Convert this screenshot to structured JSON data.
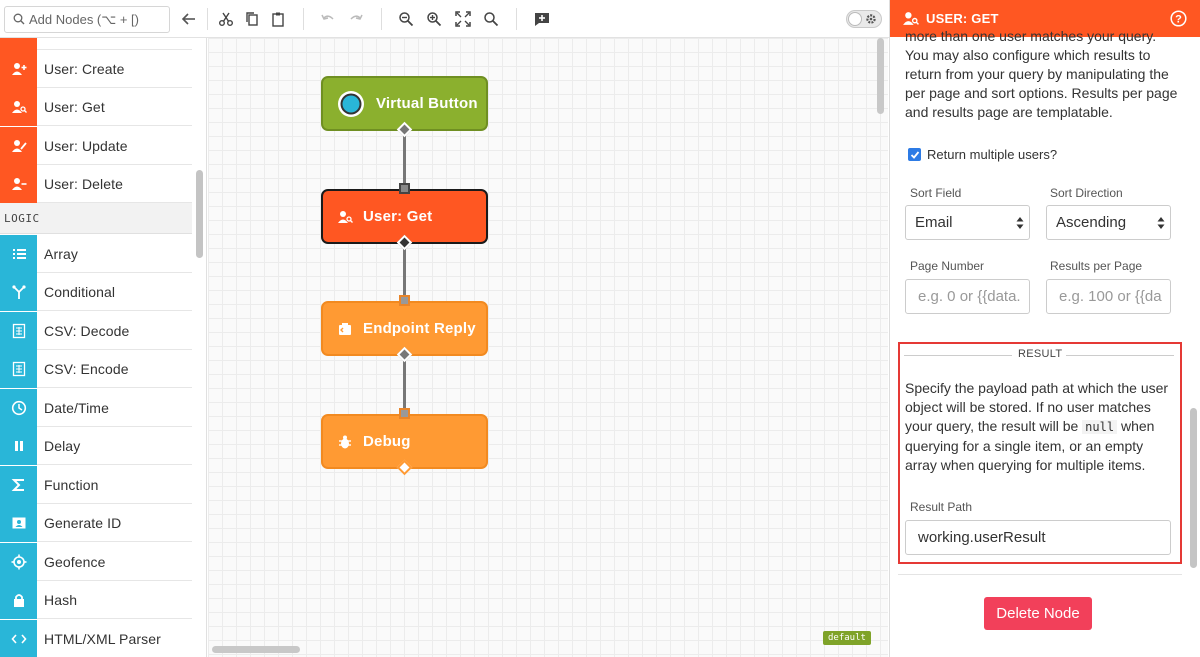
{
  "toolbar": {
    "search_placeholder": "Add Nodes (⌥ + [)",
    "buttons": [
      "back",
      "cut",
      "copy",
      "paste",
      "undo",
      "redo",
      "zoom-out",
      "zoom-in",
      "fit",
      "zoom-reset",
      "add-annotation"
    ]
  },
  "palette": {
    "section_label": "LOGIC",
    "user_items": [
      {
        "label": "User: Create",
        "icon": "user-plus-icon"
      },
      {
        "label": "User: Get",
        "icon": "user-search-icon"
      },
      {
        "label": "User: Update",
        "icon": "user-edit-icon"
      },
      {
        "label": "User: Delete",
        "icon": "user-minus-icon"
      }
    ],
    "logic_items": [
      {
        "label": "Array",
        "icon": "list-icon"
      },
      {
        "label": "Conditional",
        "icon": "branch-icon"
      },
      {
        "label": "CSV: Decode",
        "icon": "csv-icon"
      },
      {
        "label": "CSV: Encode",
        "icon": "csv-icon"
      },
      {
        "label": "Date/Time",
        "icon": "clock-icon"
      },
      {
        "label": "Delay",
        "icon": "pause-icon"
      },
      {
        "label": "Function",
        "icon": "sigma-icon"
      },
      {
        "label": "Generate ID",
        "icon": "id-card-icon"
      },
      {
        "label": "Geofence",
        "icon": "crosshair-icon"
      },
      {
        "label": "Hash",
        "icon": "lock-icon"
      },
      {
        "label": "HTML/XML Parser",
        "icon": "code-icon"
      }
    ]
  },
  "canvas": {
    "nodes": [
      {
        "label": "Virtual Button"
      },
      {
        "label": "User: Get"
      },
      {
        "label": "Endpoint Reply"
      },
      {
        "label": "Debug"
      }
    ],
    "badge": "default"
  },
  "panel": {
    "title": "USER: GET",
    "description_top": "more than one user matches your query. You may also configure which results to return from your query by manipulating the per page and sort options. Results per page and results page are templatable.",
    "return_multiple_label": "Return multiple users?",
    "return_multiple_checked": true,
    "sort_field_label": "Sort Field",
    "sort_field_value": "Email",
    "sort_direction_label": "Sort Direction",
    "sort_direction_value": "Ascending",
    "page_number_label": "Page Number",
    "page_number_placeholder": "e.g. 0 or {{data.",
    "results_per_page_label": "Results per Page",
    "results_per_page_placeholder": "e.g. 100 or {{da",
    "result": {
      "heading": "RESULT",
      "desc_1": "Specify the payload path at which the user object will be stored. If no user matches your query, the result will be ",
      "desc_code": "null",
      "desc_2": " when querying for a single item, or an empty array when querying for multiple items.",
      "path_label": "Result Path",
      "path_value": "working.userResult"
    },
    "delete_label": "Delete Node"
  },
  "colors": {
    "orange": "#ff5722",
    "cyan": "#29b6d8",
    "green": "#8bb02e",
    "light_orange": "#ff9a33",
    "delete_red": "#f2405a",
    "highlight_red": "#e53935"
  }
}
